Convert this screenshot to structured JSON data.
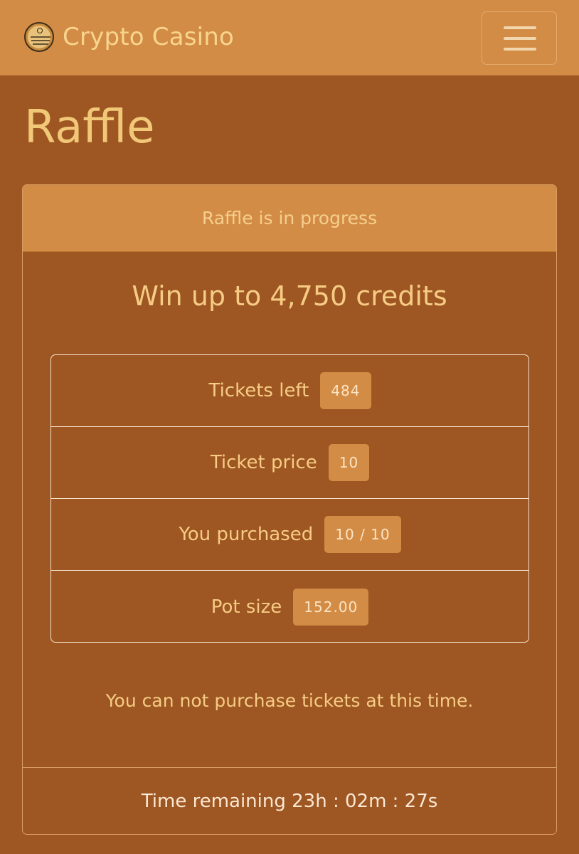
{
  "navbar": {
    "brand": "Crypto Casino",
    "logo_icon": "casino-logo-icon",
    "menu_icon": "hamburger-menu-icon"
  },
  "page": {
    "title": "Raffle"
  },
  "raffle": {
    "status": "Raffle is in progress",
    "headline": "Win up to 4,750 credits",
    "stats": [
      {
        "label": "Tickets left",
        "value": "484"
      },
      {
        "label": "Ticket price",
        "value": "10"
      },
      {
        "label": "You purchased",
        "value": "10 / 10"
      },
      {
        "label": "Pot size",
        "value": "152.00"
      }
    ],
    "notice": "You can not purchase tickets at this time.",
    "time_remaining": "Time remaining 23h : 02m : 27s"
  },
  "colors": {
    "background": "#9e5622",
    "navbar": "#d38c45",
    "text": "#f1c778",
    "badge": "#d38c45"
  }
}
